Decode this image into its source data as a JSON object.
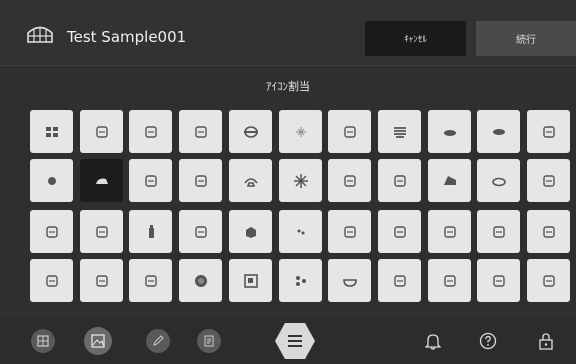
{
  "header": {
    "title": "Test Sample001",
    "cancel_label": "ｷｬﾝｾﾙ",
    "next_label": "続行"
  },
  "section": {
    "title": "ｱｲｺﾝ割当"
  },
  "icon_grid": {
    "rows": [
      [
        "grid-icon",
        "bread-roll-icon",
        "pretzel-icon",
        "croissant-icon",
        "tray-icon",
        "sparkle-icon",
        "card-icon",
        "stack-icon",
        "bowl-icon",
        "bowl-lid-icon",
        "arrows-icon"
      ],
      [
        "dot-icon",
        "selected-item-icon",
        "baguette-icon",
        "herb-icon",
        "telephone-icon",
        "snowflake-icon",
        "card-alt-icon",
        "grid-square-icon",
        "cake-slice-icon",
        "pie-icon",
        "glass-pair-icon"
      ],
      [
        "leaf-icon",
        "search-bread-icon",
        "bottle-icon",
        "bowl-mix-icon",
        "box-icon",
        "dots-icon",
        "paper-icon",
        "kettle-icon",
        "cup-icon",
        "wifi-icon",
        "glass-alt-icon"
      ],
      [
        "carrot-icon",
        "loaf-icon",
        "bun-icon",
        "circle-icon",
        "square-dot-icon",
        "cluster-icon",
        "soup-icon",
        "pizza-icon",
        "jar-icon",
        "repeat-icon",
        "l-shape-icon"
      ]
    ],
    "selected": "1-1"
  },
  "bottombar": {
    "items": [
      "layout-icon",
      "image-icon",
      "pencil-icon",
      "document-icon",
      "menu-icon",
      "bell-icon",
      "help-icon",
      "lock-icon"
    ]
  }
}
